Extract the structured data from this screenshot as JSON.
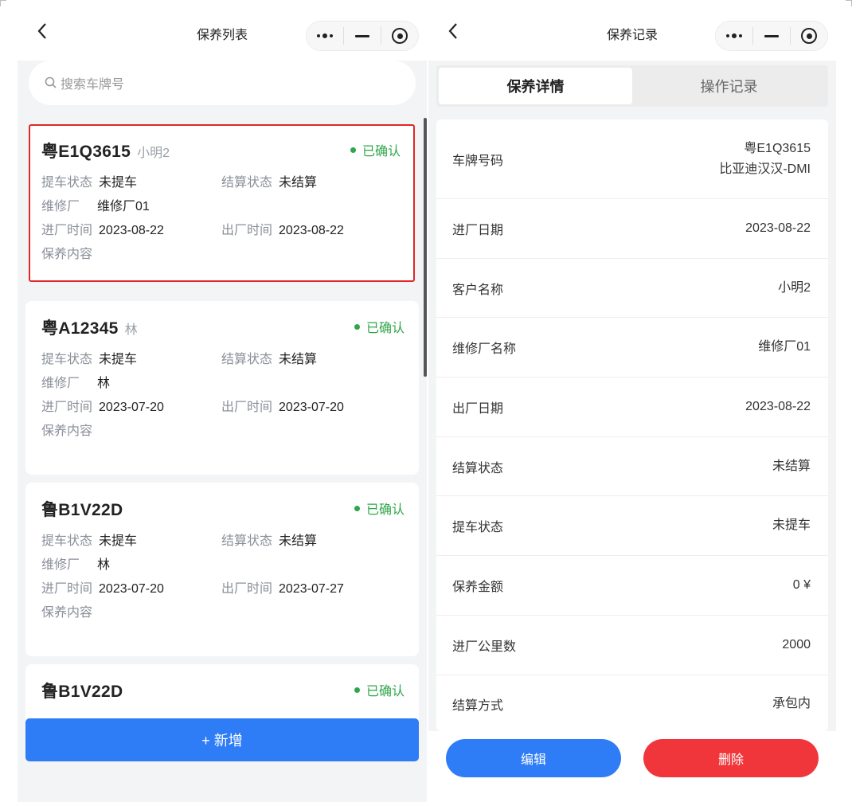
{
  "list_page": {
    "title": "保养列表",
    "search_placeholder": "搜索车牌号",
    "add_button": "+ 新增",
    "cards": [
      {
        "plate": "粤E1Q3615",
        "owner": "小明2",
        "status": "已确认",
        "pickup_label": "提车状态",
        "pickup": "未提车",
        "settle_label": "结算状态",
        "settle": "未结算",
        "shop_label": "维修厂",
        "shop": "维修厂01",
        "in_label": "进厂时间",
        "in_time": "2023-08-22",
        "out_label": "出厂时间",
        "out_time": "2023-08-22",
        "content_label": "保养内容"
      },
      {
        "plate": "粤A12345",
        "owner": "林",
        "status": "已确认",
        "pickup_label": "提车状态",
        "pickup": "未提车",
        "settle_label": "结算状态",
        "settle": "未结算",
        "shop_label": "维修厂",
        "shop": "林",
        "in_label": "进厂时间",
        "in_time": "2023-07-20",
        "out_label": "出厂时间",
        "out_time": "2023-07-20",
        "content_label": "保养内容"
      },
      {
        "plate": "鲁B1V22D",
        "owner": "",
        "status": "已确认",
        "pickup_label": "提车状态",
        "pickup": "未提车",
        "settle_label": "结算状态",
        "settle": "未结算",
        "shop_label": "维修厂",
        "shop": "林",
        "in_label": "进厂时间",
        "in_time": "2023-07-20",
        "out_label": "出厂时间",
        "out_time": "2023-07-27",
        "content_label": "保养内容"
      },
      {
        "plate": "鲁B1V22D",
        "owner": "",
        "status": "已确认"
      }
    ]
  },
  "detail_page": {
    "title": "保养记录",
    "tabs": [
      "保养详情",
      "操作记录"
    ],
    "rows": [
      {
        "key": "车牌号码",
        "value": "粤E1Q3615",
        "value2": "比亚迪汉汉-DMI"
      },
      {
        "key": "进厂日期",
        "value": "2023-08-22"
      },
      {
        "key": "客户名称",
        "value": "小明2"
      },
      {
        "key": "维修厂名称",
        "value": "维修厂01"
      },
      {
        "key": "出厂日期",
        "value": "2023-08-22"
      },
      {
        "key": "结算状态",
        "value": "未结算"
      },
      {
        "key": "提车状态",
        "value": "未提车"
      },
      {
        "key": "保养金额",
        "value": "0 ¥"
      },
      {
        "key": "进厂公里数",
        "value": "2000"
      },
      {
        "key": "结算方式",
        "value": "承包内"
      }
    ],
    "edit_button": "编辑",
    "delete_button": "删除"
  },
  "icons": {
    "back": "chevron-left-icon",
    "more": "more-dots-icon",
    "minimize": "minus-icon",
    "close": "target-circle-icon",
    "search": "search-icon"
  },
  "colors": {
    "primary": "#2e7cf6",
    "danger": "#f0363b",
    "confirmed": "#2fa64a",
    "highlight_border": "#e02727"
  }
}
